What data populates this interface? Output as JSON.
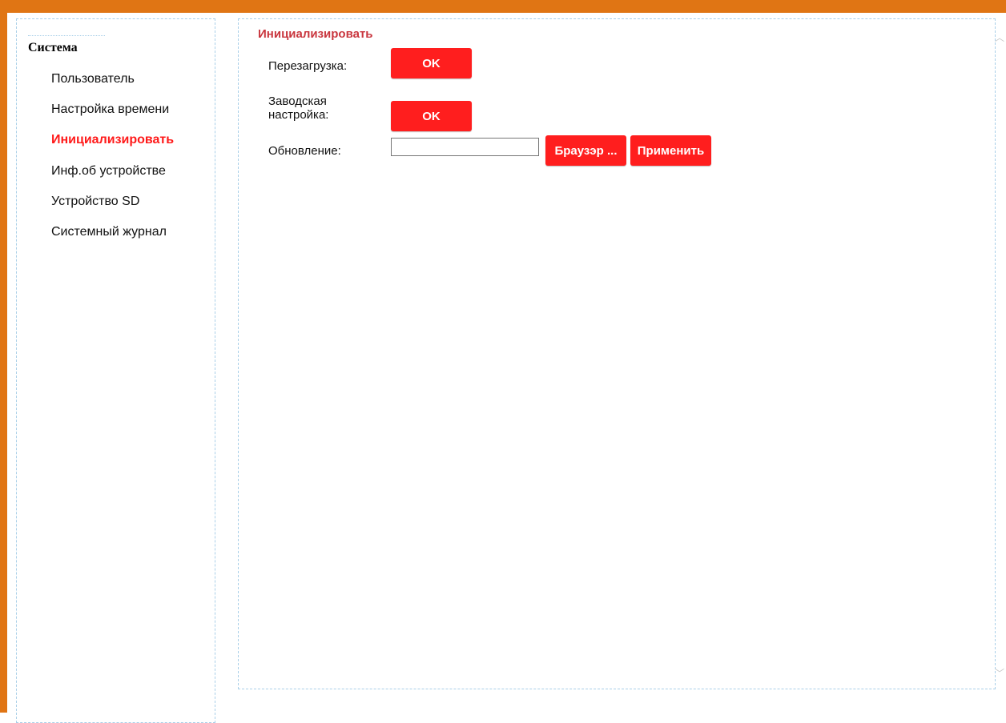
{
  "sidebar": {
    "title": "Система",
    "items": [
      {
        "label": "Пользователь"
      },
      {
        "label": "Настройка времени"
      },
      {
        "label": "Инициализировать",
        "active": true
      },
      {
        "label": "Инф.об устройстве"
      },
      {
        "label": "Устройство SD"
      },
      {
        "label": "Системный журнал"
      }
    ]
  },
  "main": {
    "title": "Инициализировать",
    "reboot": {
      "label": "Перезагрузка:",
      "button": "OK"
    },
    "factory": {
      "label_line1": "Заводская",
      "label_line2": "настройка:",
      "button": "OK"
    },
    "update": {
      "label": "Обновление:",
      "file_value": "",
      "browse_button": "Браузэр ...",
      "apply_button": "Применить"
    }
  },
  "colors": {
    "frame": "#e07514",
    "accent": "#ff1e1e",
    "title": "#c9363e",
    "active_item": "#ff1a1a",
    "border": "#a9cfe8"
  },
  "icons": {
    "scroll_up": "chevron-up-icon",
    "scroll_down": "chevron-down-icon"
  }
}
